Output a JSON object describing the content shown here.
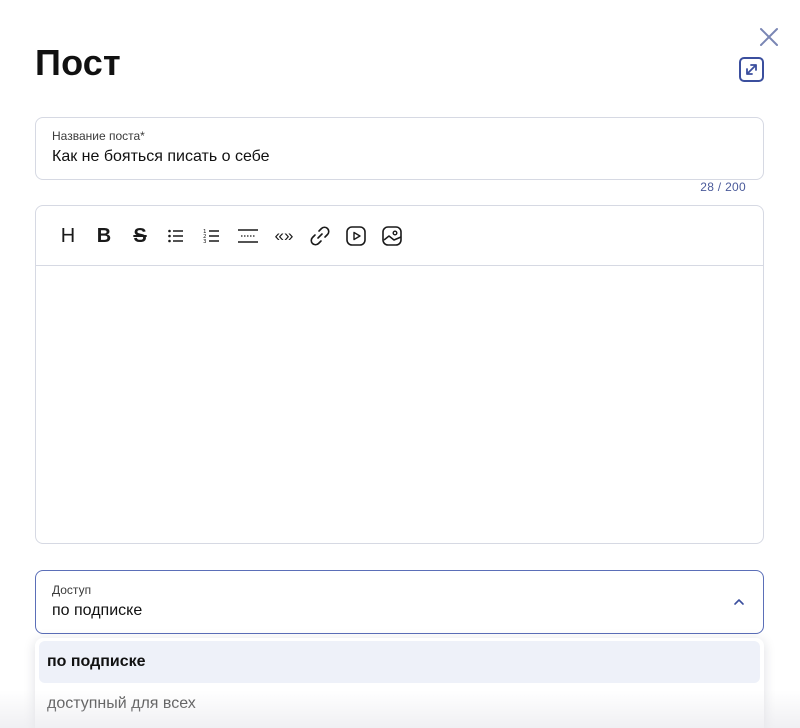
{
  "header": {
    "title": "Пост"
  },
  "title_field": {
    "label": "Название поста*",
    "value": "Как не бояться писать о себе",
    "counter": "28 / 200"
  },
  "editor": {
    "toolbar": [
      {
        "name": "heading-button",
        "icon": "heading-icon",
        "text": "H"
      },
      {
        "name": "bold-button",
        "icon": "bold-icon",
        "text": "B"
      },
      {
        "name": "strikethrough-button",
        "icon": "strikethrough-icon",
        "text": "S"
      },
      {
        "name": "bullet-list-button",
        "icon": "bullet-list-icon"
      },
      {
        "name": "numbered-list-button",
        "icon": "numbered-list-icon"
      },
      {
        "name": "divider-button",
        "icon": "horizontal-rule-icon"
      },
      {
        "name": "quote-button",
        "icon": "quote-icon",
        "text": "«»"
      },
      {
        "name": "link-button",
        "icon": "link-icon"
      },
      {
        "name": "video-button",
        "icon": "video-icon"
      },
      {
        "name": "image-button",
        "icon": "image-icon"
      }
    ],
    "body_text": ""
  },
  "access": {
    "label": "Доступ",
    "value": "по подписке",
    "options": [
      "по подписке",
      "доступный для всех"
    ],
    "selected_index": 0
  },
  "colors": {
    "accent": "#5b6fb8",
    "selected_bg": "#eef1f9",
    "border": "#d6d9e3"
  }
}
